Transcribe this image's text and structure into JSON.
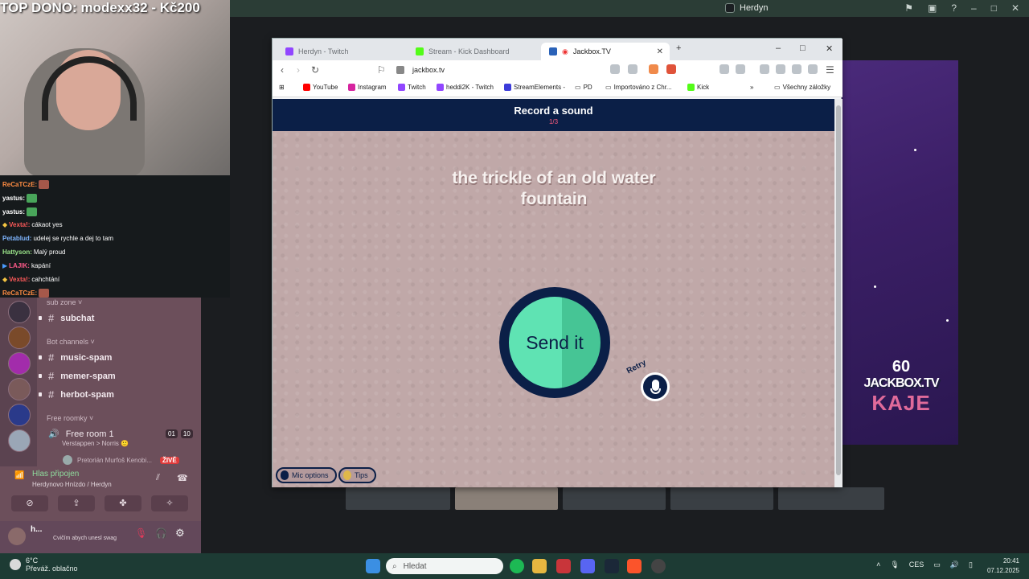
{
  "stream": {
    "top_donor": "TOP DONO: modexx32 - Kč200"
  },
  "chat": [
    {
      "user": "ReCaTCzE:",
      "text": "",
      "color": "#ff8c42",
      "emote": "red"
    },
    {
      "user": "yastus:",
      "text": "",
      "color": "#ffffff",
      "emote": "green"
    },
    {
      "user": "yastus:",
      "text": "",
      "color": "#ffffff",
      "emote": "green"
    },
    {
      "user": "Vexta!:",
      "text": "cákaot yes",
      "color": "#ff5a5a",
      "emote": ""
    },
    {
      "user": "Petablud:",
      "text": "udelej se rychle a dej to tam",
      "color": "#7fb6ff",
      "emote": ""
    },
    {
      "user": "Hattyson:",
      "text": "Malý proud",
      "color": "#9be58a",
      "emote": ""
    },
    {
      "user": "LAJIK:",
      "text": "kapání",
      "color": "#ff5a8a",
      "emote": ""
    },
    {
      "user": "Vexta!:",
      "text": "cahchtání",
      "color": "#ff5a5a",
      "emote": ""
    },
    {
      "user": "ReCaTCzE:",
      "text": "",
      "color": "#ff8c42",
      "emote": "red"
    }
  ],
  "discord": {
    "window_title": "Herdyn",
    "categories": {
      "sub_zone": "sub zone",
      "bot_channels": "Bot channels",
      "free_rooms": "Free roomky"
    },
    "channels": {
      "subchat": "subchat",
      "music_spam": "music-spam",
      "memer_spam": "memer-spam",
      "herbot_spam": "herbot-spam"
    },
    "free_room": {
      "name": "Free room 1",
      "count_a": "01",
      "count_b": "10",
      "status": "Verstappen > Norris 🙂",
      "member": "Pretorián Murfoš Kenobi...",
      "live_badge": "ŽIVĚ"
    },
    "voice": {
      "status": "Hlas připojen",
      "location": "Herdynovo Hnízdo / Herdyn"
    },
    "user": {
      "name": "h...",
      "status": "Cvičím abych unesl swag"
    }
  },
  "browser": {
    "tabs": [
      {
        "label": "Herdyn - Twitch",
        "color": "#9146ff"
      },
      {
        "label": "Stream - Kick Dashboard",
        "color": "#53fc18"
      },
      {
        "label": "Jackbox.TV",
        "color": "#2a62b8"
      }
    ],
    "url": "jackbox.tv",
    "bookmarks": [
      {
        "label": "YouTube",
        "color": "#ff0000"
      },
      {
        "label": "Instagram",
        "color": "#d6249f"
      },
      {
        "label": "Twitch",
        "color": "#9146ff"
      },
      {
        "label": "heddi2K - Twitch",
        "color": "#9146ff"
      },
      {
        "label": "StreamElements -",
        "color": "#3b3bd9"
      },
      {
        "label": "PD",
        "color": ""
      },
      {
        "label": "Importováno z Chr...",
        "color": ""
      },
      {
        "label": "Kick",
        "color": "#53fc18"
      }
    ],
    "all_bookmarks": "Všechny záložky",
    "overflow": "»"
  },
  "jackbox": {
    "header_title": "Record a sound",
    "progress": "1/3",
    "prompt": "the trickle of an old water fountain",
    "send_label": "Send it",
    "retry_label": "Retry",
    "mic_options": "Mic options",
    "tips": "Tips"
  },
  "art_panel": {
    "number": "60",
    "brand": "JACKBOX.TV",
    "name": "KAJE"
  },
  "taskbar": {
    "temperature": "6°C",
    "weather": "Převáž. oblačno",
    "search_placeholder": "Hledat",
    "language": "CES",
    "time": "20:41",
    "date": "07.12.2025"
  },
  "colors": {
    "jackbox_navy": "#0b1f47",
    "jackbox_green": "#5fe3b3",
    "jackbox_bg": "#c0a8a8"
  }
}
